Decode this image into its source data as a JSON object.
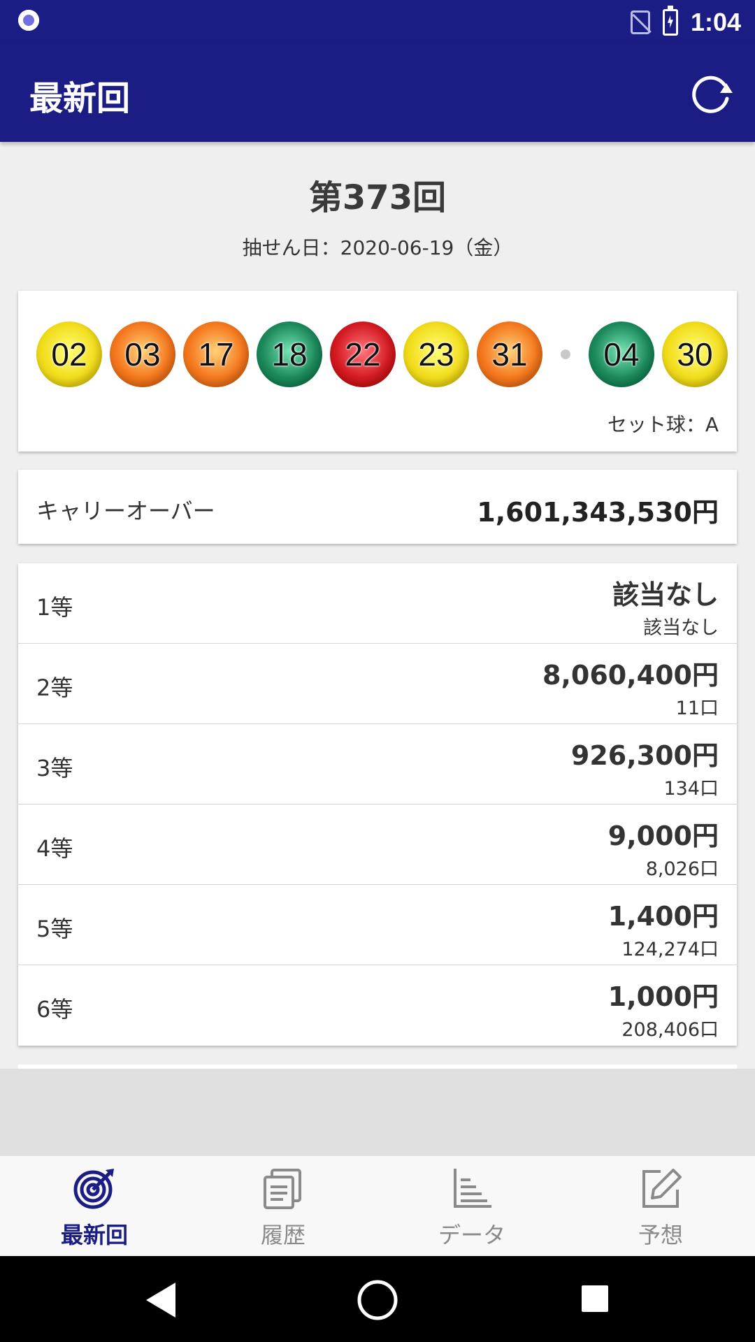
{
  "status_bar": {
    "time": "1:04"
  },
  "app_bar": {
    "title": "最新回"
  },
  "draw": {
    "title": "第373回",
    "date": "抽せん日：2020-06-19（金）",
    "main_numbers": [
      "02",
      "03",
      "17",
      "18",
      "22",
      "23",
      "31"
    ],
    "bonus_numbers": [
      "04",
      "30"
    ],
    "ball_colors": {
      "02": "#f2dd1d",
      "03": "#f5781f",
      "17": "#f5781f",
      "18": "#1d8a5c",
      "22": "#d41b22",
      "23": "#f2dd1d",
      "31": "#f5781f",
      "04": "#1d8a5c",
      "30": "#f2dd1d"
    },
    "set_ball": "セット球：A"
  },
  "carryover": {
    "label": "キャリーオーバー",
    "value": "1,601,343,530円"
  },
  "prizes": [
    {
      "rank": "1等",
      "amount": "該当なし",
      "count": "該当なし"
    },
    {
      "rank": "2等",
      "amount": "8,060,400円",
      "count": "11口"
    },
    {
      "rank": "3等",
      "amount": "926,300円",
      "count": "134口"
    },
    {
      "rank": "4等",
      "amount": "9,000円",
      "count": "8,026口"
    },
    {
      "rank": "5等",
      "amount": "1,400円",
      "count": "124,274口"
    },
    {
      "rank": "6等",
      "amount": "1,000円",
      "count": "208,406口"
    }
  ],
  "bottom_nav": [
    {
      "label": "最新回",
      "icon": "target-icon",
      "active": true
    },
    {
      "label": "履歴",
      "icon": "history-icon",
      "active": false
    },
    {
      "label": "データ",
      "icon": "chart-icon",
      "active": false
    },
    {
      "label": "予想",
      "icon": "edit-icon",
      "active": false
    }
  ],
  "colors": {
    "primary": "#1b1d84"
  }
}
